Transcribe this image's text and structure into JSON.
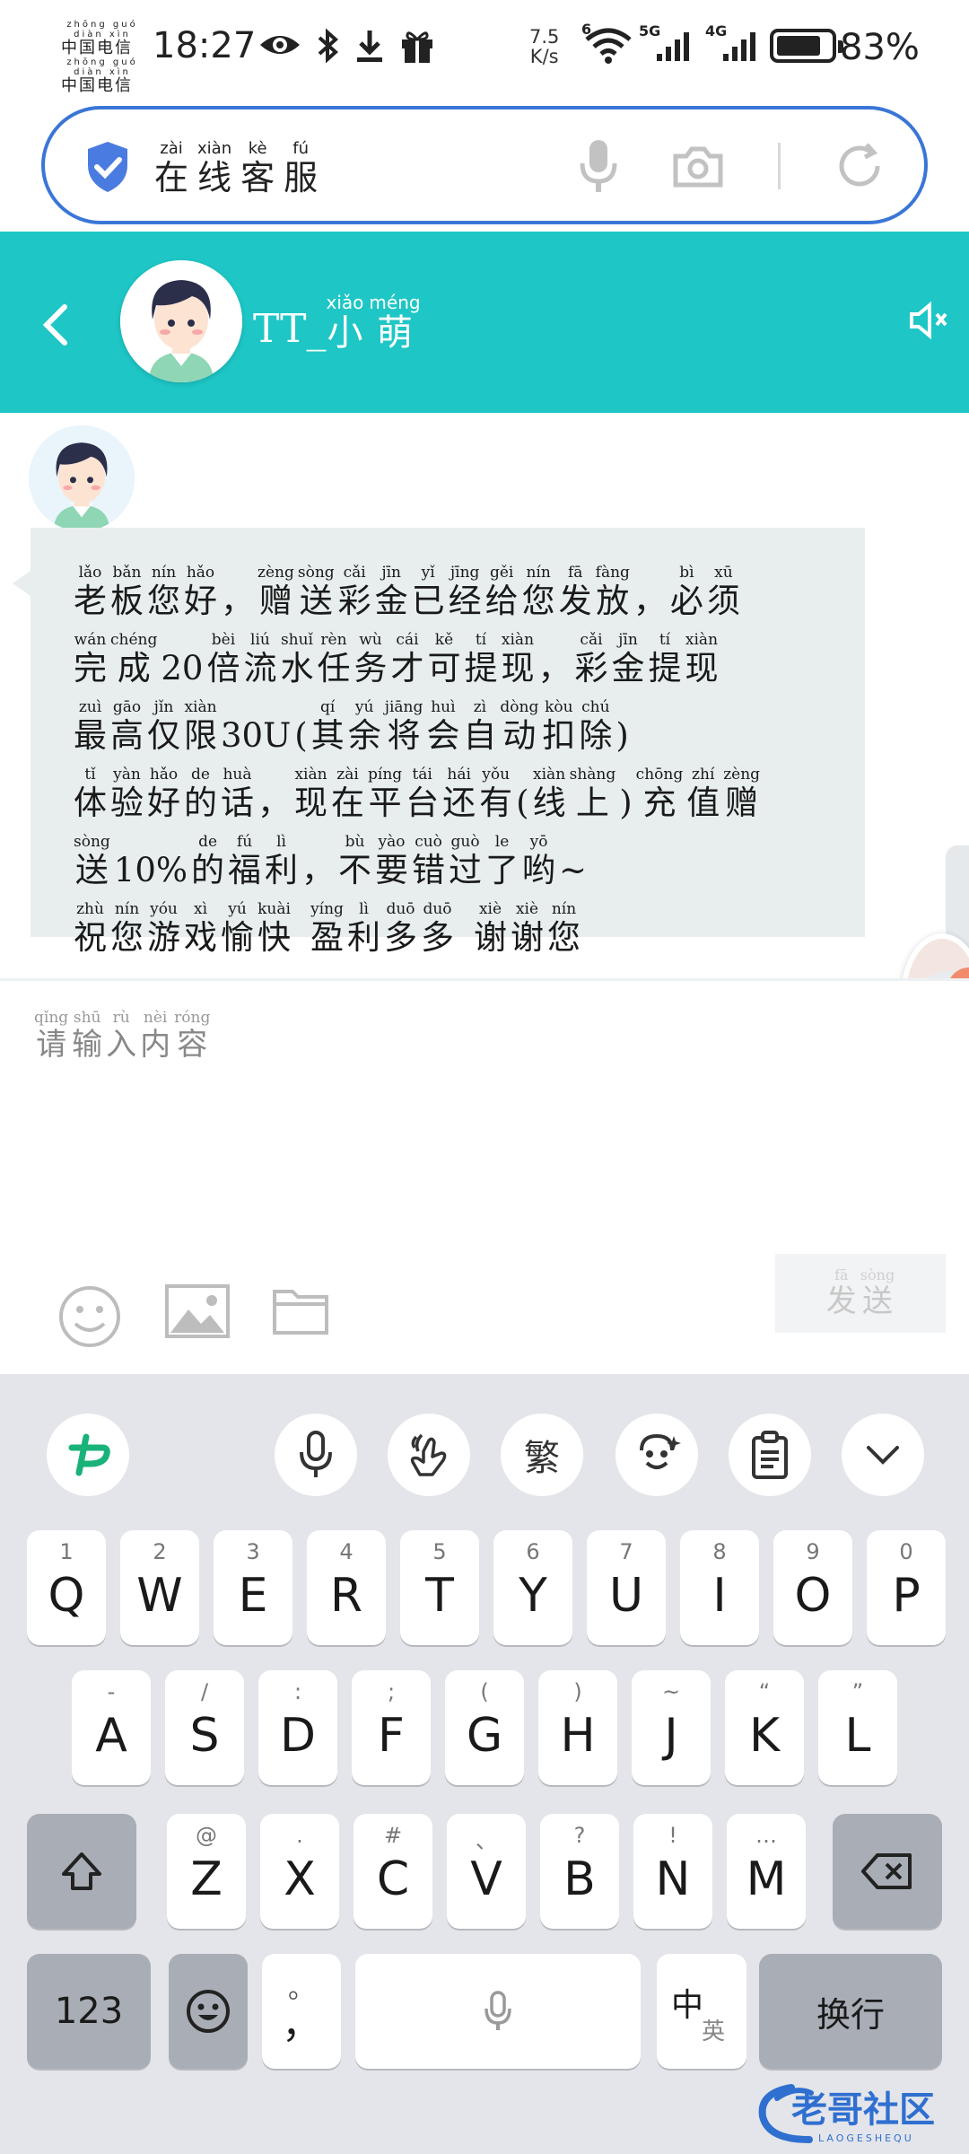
{
  "status_bar": {
    "carrier_1_pinyin": "zhōng guó diàn xìn",
    "carrier_1": "中国电信",
    "carrier_2_pinyin": "zhōng guó diàn xìn",
    "carrier_2": "中国电信",
    "time": "18:27",
    "net_speed_value": "7.5",
    "net_speed_unit": "K/s",
    "wifi_badge": "6",
    "sig1_label": "5G",
    "sig2_label": "4G",
    "battery_level": 0.83,
    "battery_text": "83%"
  },
  "browser": {
    "search_pinyin": [
      "zài",
      "xiàn",
      "kè",
      "fú"
    ],
    "search_chars": [
      "在",
      "线",
      "客",
      "服"
    ],
    "accent_color": "#3a76d6"
  },
  "chat_header": {
    "name_prefix": "TT_",
    "name_pinyin": [
      "xiǎo",
      "méng"
    ],
    "name_chars": [
      "小",
      "萌"
    ],
    "bg_color": "#1ec6c6"
  },
  "message": {
    "lines": [
      [
        [
          "lǎo",
          "老"
        ],
        [
          "bǎn",
          "板"
        ],
        [
          "nín",
          "您"
        ],
        [
          "hǎo",
          "好"
        ],
        [
          "",
          "，"
        ],
        [
          "zèng",
          "赠"
        ],
        [
          "sòng",
          "送"
        ],
        [
          "cǎi",
          "彩"
        ],
        [
          "jīn",
          "金"
        ],
        [
          "yǐ",
          "已"
        ],
        [
          "jīng",
          "经"
        ],
        [
          "gěi",
          "给"
        ],
        [
          "nín",
          "您"
        ],
        [
          "fā",
          "发"
        ],
        [
          "fàng",
          "放"
        ],
        [
          "",
          "，"
        ],
        [
          "bì",
          "必"
        ],
        [
          "xū",
          "须"
        ]
      ],
      [
        [
          "wán",
          "完"
        ],
        [
          "chéng",
          "成"
        ],
        [
          "",
          "20"
        ],
        [
          "bèi",
          "倍"
        ],
        [
          "liú",
          "流"
        ],
        [
          "shuǐ",
          "水"
        ],
        [
          "rèn",
          "任"
        ],
        [
          "wù",
          "务"
        ],
        [
          "cái",
          "才"
        ],
        [
          "kě",
          "可"
        ],
        [
          "tí",
          "提"
        ],
        [
          "xiàn",
          "现"
        ],
        [
          "",
          "，"
        ],
        [
          "cǎi",
          "彩"
        ],
        [
          "jīn",
          "金"
        ],
        [
          "tí",
          "提"
        ],
        [
          "xiàn",
          "现"
        ]
      ],
      [
        [
          "zuì",
          "最"
        ],
        [
          "gāo",
          "高"
        ],
        [
          "jǐn",
          "仅"
        ],
        [
          "xiàn",
          "限"
        ],
        [
          "",
          "30U"
        ],
        [
          "",
          "("
        ],
        [
          "qí",
          "其"
        ],
        [
          "yú",
          "余"
        ],
        [
          "jiāng",
          "将"
        ],
        [
          "huì",
          "会"
        ],
        [
          "zì",
          "自"
        ],
        [
          "dòng",
          "动"
        ],
        [
          "kòu",
          "扣"
        ],
        [
          "chú",
          "除"
        ],
        [
          "",
          ")"
        ]
      ],
      [
        [
          "tǐ",
          "体"
        ],
        [
          "yàn",
          "验"
        ],
        [
          "hǎo",
          "好"
        ],
        [
          "de",
          "的"
        ],
        [
          "huà",
          "话"
        ],
        [
          "",
          "，"
        ],
        [
          "xiàn",
          "现"
        ],
        [
          "zài",
          "在"
        ],
        [
          "píng",
          "平"
        ],
        [
          "tái",
          "台"
        ],
        [
          "hái",
          "还"
        ],
        [
          "yǒu",
          "有"
        ],
        [
          "",
          "("
        ],
        [
          "xiàn",
          "线"
        ],
        [
          "shàng",
          "上"
        ],
        [
          "",
          ")"
        ],
        [
          "chōng",
          "充"
        ],
        [
          "zhí",
          "值"
        ],
        [
          "zèng",
          "赠"
        ]
      ],
      [
        [
          "sòng",
          "送"
        ],
        [
          "",
          "10%"
        ],
        [
          "de",
          "的"
        ],
        [
          "fú",
          "福"
        ],
        [
          "lì",
          "利"
        ],
        [
          "",
          "，"
        ],
        [
          "bù",
          "不"
        ],
        [
          "yào",
          "要"
        ],
        [
          "cuò",
          "错"
        ],
        [
          "guò",
          "过"
        ],
        [
          "le",
          "了"
        ],
        [
          "yō",
          "哟"
        ],
        [
          "",
          "~"
        ]
      ],
      [
        [
          "zhù",
          "祝"
        ],
        [
          "nín",
          "您"
        ],
        [
          "yóu",
          "游"
        ],
        [
          "xì",
          "戏"
        ],
        [
          "yú",
          "愉"
        ],
        [
          "kuài",
          "快"
        ],
        [
          "",
          ""
        ],
        [
          "yíng",
          "盈"
        ],
        [
          "lì",
          "利"
        ],
        [
          "duō",
          "多"
        ],
        [
          "duō",
          "多"
        ],
        [
          "",
          ""
        ],
        [
          "xiè",
          "谢"
        ],
        [
          "xiè",
          "谢"
        ],
        [
          "nín",
          "您"
        ]
      ]
    ]
  },
  "input": {
    "placeholder_pinyin": [
      "qǐng",
      "shū",
      "rù",
      "nèi",
      "róng"
    ],
    "placeholder_chars": [
      "请",
      "输",
      "入",
      "内",
      "容"
    ],
    "send_pinyin": [
      "fā",
      "sòng"
    ],
    "send_chars": [
      "发",
      "送"
    ],
    "tools": [
      "emoji-icon",
      "image-icon",
      "folder-icon"
    ]
  },
  "keyboard": {
    "toolbar": [
      "logo-icon",
      "mic-icon",
      "handwriting-icon",
      "繁",
      "face-icon",
      "clipboard-icon",
      "chevron-down-icon"
    ],
    "traditional_label": "繁",
    "row1": [
      [
        "1",
        "Q"
      ],
      [
        "2",
        "W"
      ],
      [
        "3",
        "E"
      ],
      [
        "4",
        "R"
      ],
      [
        "5",
        "T"
      ],
      [
        "6",
        "Y"
      ],
      [
        "7",
        "U"
      ],
      [
        "8",
        "I"
      ],
      [
        "9",
        "O"
      ],
      [
        "0",
        "P"
      ]
    ],
    "row2": [
      [
        "-",
        "A"
      ],
      [
        "/",
        "S"
      ],
      [
        ":",
        "D"
      ],
      [
        ";",
        "F"
      ],
      [
        "(",
        "G"
      ],
      [
        ")",
        "H"
      ],
      [
        "~",
        "J"
      ],
      [
        "“",
        "K"
      ],
      [
        "”",
        "L"
      ]
    ],
    "row3": [
      [
        "@",
        "Z"
      ],
      [
        ".",
        "X"
      ],
      [
        "#",
        "C"
      ],
      [
        "、",
        "V"
      ],
      [
        "?",
        "B"
      ],
      [
        "!",
        "N"
      ],
      [
        "…",
        "M"
      ]
    ],
    "num_key": "123",
    "punct_hint": "。",
    "punct_main": "，",
    "lang_main": "中",
    "lang_sub": "英",
    "enter_key": "换行"
  },
  "watermark": {
    "title": "老哥社区",
    "sub": "LAOGESHEQU"
  }
}
